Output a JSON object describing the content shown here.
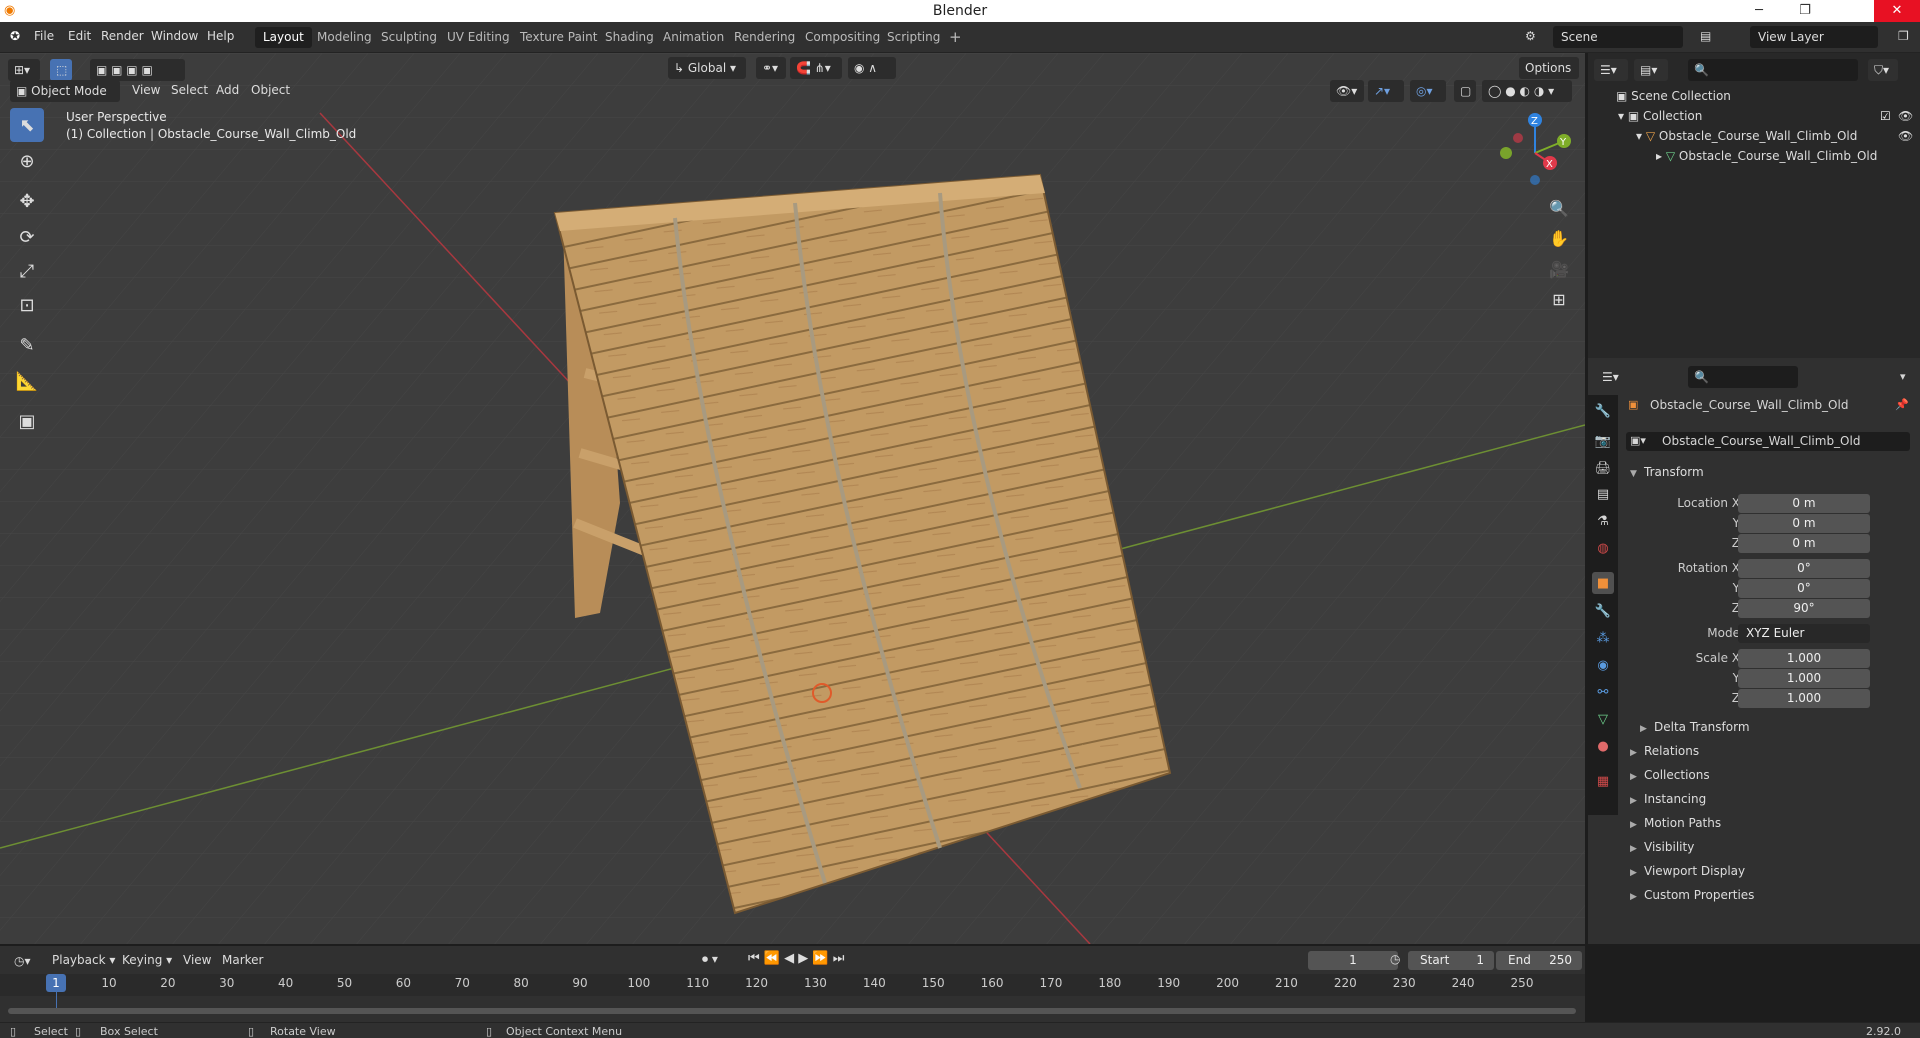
{
  "app": {
    "title": "Blender",
    "version": "2.92.0"
  },
  "menu": [
    "File",
    "Edit",
    "Render",
    "Window",
    "Help"
  ],
  "workspaces": [
    "Layout",
    "Modeling",
    "Sculpting",
    "UV Editing",
    "Texture Paint",
    "Shading",
    "Animation",
    "Rendering",
    "Compositing",
    "Scripting"
  ],
  "active_workspace": "Layout",
  "add_workspace": "+",
  "scene": {
    "name": "Scene",
    "view_layer": "View Layer"
  },
  "viewport": {
    "mode": "Object Mode",
    "header_menus": [
      "View",
      "Select",
      "Add",
      "Object"
    ],
    "orientation": "Global",
    "options": "Options",
    "perspective": "User Perspective",
    "collection_info": "(1) Collection | Obstacle_Course_Wall_Climb_Old",
    "gizmo": {
      "x": "X",
      "y": "Y",
      "z": "Z"
    }
  },
  "outliner": {
    "scene_collection": "Scene Collection",
    "collection": "Collection",
    "object": "Obstacle_Course_Wall_Climb_Old",
    "mesh": "Obstacle_Course_Wall_Climb_Old"
  },
  "properties": {
    "object_name": "Obstacle_Course_Wall_Climb_Old",
    "data_name": "Obstacle_Course_Wall_Climb_Old",
    "transform_title": "Transform",
    "location": {
      "label": "Location X",
      "x": "0 m",
      "y": "0 m",
      "z": "0 m"
    },
    "rotation": {
      "label": "Rotation X",
      "x": "0°",
      "y": "0°",
      "z": "90°"
    },
    "mode": {
      "label": "Mode",
      "value": "XYZ Euler"
    },
    "scale": {
      "label": "Scale X",
      "x": "1.000",
      "y": "1.000",
      "z": "1.000"
    },
    "axis_y": "Y",
    "axis_z": "Z",
    "delta": "Delta Transform",
    "sections": [
      "Relations",
      "Collections",
      "Instancing",
      "Motion Paths",
      "Visibility",
      "Viewport Display",
      "Custom Properties"
    ]
  },
  "timeline": {
    "menus": [
      "Playback",
      "Keying",
      "View",
      "Marker"
    ],
    "current_frame": "1",
    "start_label": "Start",
    "start": "1",
    "end_label": "End",
    "end": "250",
    "ticks": [
      "1",
      "10",
      "20",
      "30",
      "40",
      "50",
      "60",
      "70",
      "80",
      "90",
      "100",
      "110",
      "120",
      "130",
      "140",
      "150",
      "160",
      "170",
      "180",
      "190",
      "200",
      "210",
      "220",
      "230",
      "240",
      "250"
    ]
  },
  "statusbar": {
    "select": "Select",
    "box_select": "Box Select",
    "rotate": "Rotate View",
    "context": "Object Context Menu"
  },
  "colors": {
    "accent": "#4772b3",
    "x_axis": "#e0394a",
    "y_axis": "#7fae29",
    "z_axis": "#2f83e0",
    "wood": "#c9a06a"
  }
}
